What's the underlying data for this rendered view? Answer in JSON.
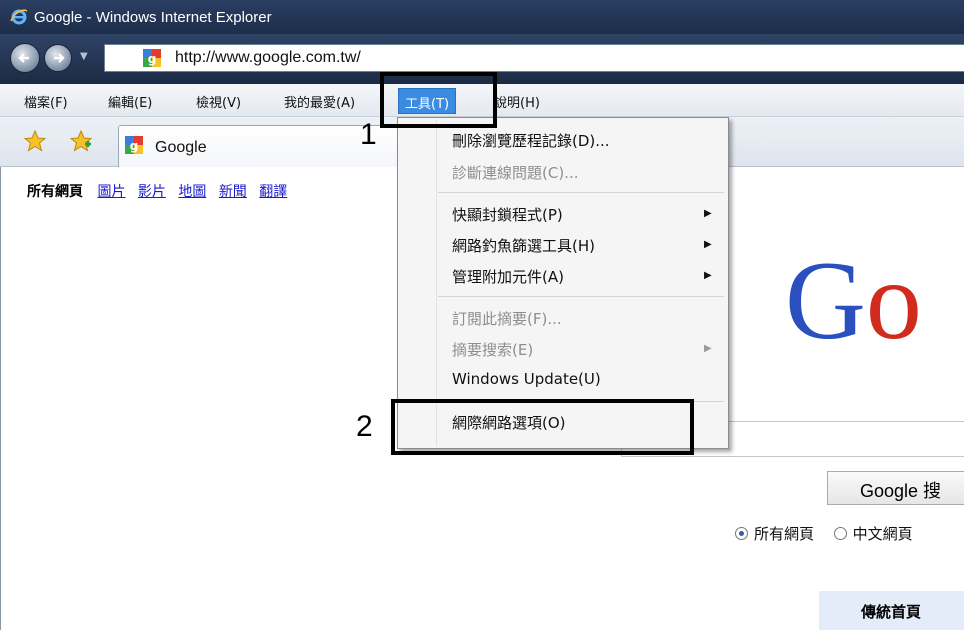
{
  "window": {
    "title": "Google - Windows Internet Explorer",
    "icon": "ie-icon"
  },
  "address_bar": {
    "url": "http://www.google.com.tw/",
    "back_icon": "back-arrow-icon",
    "forward_icon": "forward-arrow-icon"
  },
  "menu": {
    "items": [
      {
        "label": "檔案(F)"
      },
      {
        "label": "編輯(E)"
      },
      {
        "label": "檢視(V)"
      },
      {
        "label": "我的最愛(A)"
      },
      {
        "label": "工具(T)"
      },
      {
        "label": "說明(H)"
      }
    ],
    "active_index": 4
  },
  "tab": {
    "label": "Google"
  },
  "page": {
    "gbar": {
      "current": "所有網頁",
      "links": [
        "圖片",
        "影片",
        "地圖",
        "新聞",
        "翻譯"
      ]
    },
    "logo": {
      "part1": "G",
      "part2": "o"
    },
    "search_button": "Google 搜",
    "radios": [
      {
        "label": "所有網頁",
        "selected": true
      },
      {
        "label": "中文網頁",
        "selected": false
      }
    ],
    "classic_link": "傳統首頁"
  },
  "tools_menu": {
    "items": [
      {
        "label": "刪除瀏覽歷程記錄(D)...",
        "disabled": false,
        "submenu": false
      },
      {
        "label": "診斷連線問題(C)...",
        "disabled": true,
        "submenu": false
      },
      {
        "label": "快顯封鎖程式(P)",
        "disabled": false,
        "submenu": true
      },
      {
        "label": "網路釣魚篩選工具(H)",
        "disabled": false,
        "submenu": true
      },
      {
        "label": "管理附加元件(A)",
        "disabled": false,
        "submenu": true
      },
      {
        "label": "訂閱此摘要(F)...",
        "disabled": true,
        "submenu": false
      },
      {
        "label": "摘要搜索(E)",
        "disabled": true,
        "submenu": true
      },
      {
        "label": "Windows Update(U)",
        "disabled": false,
        "submenu": false
      },
      {
        "label": "網際網路選項(O)",
        "disabled": false,
        "submenu": false
      }
    ]
  },
  "annotations": {
    "step1": "1",
    "step2": "2"
  },
  "colors": {
    "menu_highlight": "#3b8be0",
    "link": "#1a1acc",
    "logo_blue": "#2a4fbf",
    "logo_red": "#d12b1e"
  }
}
